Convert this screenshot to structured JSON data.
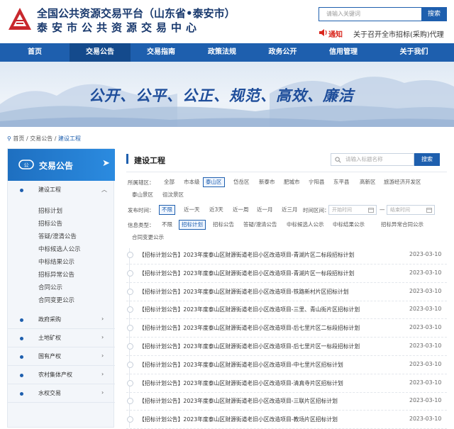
{
  "header": {
    "title_line1": "全国公共资源交易平台（山东省•泰安市）",
    "title_line2": "泰安市公共资源交易中心",
    "search_placeholder": "请输入关键词",
    "search_button": "搜索",
    "notice_label": "通知",
    "notice_text": "关于召开全市招标(采购)代理"
  },
  "nav": {
    "items": [
      "首页",
      "交易公告",
      "交易指南",
      "政策法规",
      "政务公开",
      "信用管理",
      "关于我们"
    ],
    "active_index": 1
  },
  "banner": {
    "slogan": "公开、公平、公正、规范、高效、廉洁"
  },
  "breadcrumb": {
    "home": "首页",
    "sep1": "/",
    "level1": "交易公告",
    "sep2": "/",
    "current": "建设工程"
  },
  "sidebar": {
    "heading": "交易公告",
    "heading_arrow": "➤",
    "expanded_section": {
      "label": "建设工程",
      "items": [
        "招标计划",
        "招标公告",
        "答疑/澄清公告",
        "中标候选人公示",
        "中标结果公示",
        "招标异常公告",
        "合同公示",
        "合同变更公示"
      ]
    },
    "sections": [
      "政府采购",
      "土地矿权",
      "国有产权",
      "农村集体产权",
      "水权交易"
    ]
  },
  "main": {
    "title": "建设工程",
    "search_placeholder": "请输入标题名称",
    "search_button": "搜索",
    "filters": {
      "region": {
        "label": "所属辖区：",
        "options": [
          "全部",
          "市本级",
          "泰山区",
          "岱岳区",
          "新泰市",
          "肥城市",
          "宁阳县",
          "东平县",
          "高新区",
          "旅游经济开发区",
          "泰山景区",
          "徂汶景区"
        ],
        "active_index": 2
      },
      "time": {
        "label": "发布时间：",
        "options": [
          "不限",
          "近一天",
          "近3天",
          "近一周",
          "近一月",
          "近三月"
        ],
        "active_index": 0,
        "range_label": "时间区间：",
        "start_placeholder": "开始时间",
        "end_placeholder": "结束时间",
        "range_sep": "—"
      },
      "info_type": {
        "label": "信息类型：",
        "options": [
          "不限",
          "招标计划",
          "招标公告",
          "答疑/澄清公告",
          "中标候选人公示",
          "中标结果公示",
          "招标异常",
          "合同公示",
          "合同变更公示"
        ],
        "active_index": 1
      }
    },
    "rows": [
      {
        "title": "【招标计划公告】2023年度泰山区财源街道老旧小区改造项目-青湖片区二标段招标计划",
        "date": "2023-03-10"
      },
      {
        "title": "【招标计划公告】2023年度泰山区财源街道老旧小区改造项目-青湖片区一标段招标计划",
        "date": "2023-03-10"
      },
      {
        "title": "【招标计划公告】2023年度泰山区财源街道老旧小区改造项目-铁路新村片区招标计划",
        "date": "2023-03-10"
      },
      {
        "title": "【招标计划公告】2023年度泰山区财源街道老旧小区改造项目-三里、青山街片区招标计划",
        "date": "2023-03-10"
      },
      {
        "title": "【招标计划公告】2023年度泰山区财源街道老旧小区改造项目-后七里片区二标段招标计划",
        "date": "2023-03-10"
      },
      {
        "title": "【招标计划公告】2023年度泰山区财源街道老旧小区改造项目-后七里片区一标段招标计划",
        "date": "2023-03-10"
      },
      {
        "title": "【招标计划公告】2023年度泰山区财源街道老旧小区改造项目-中七里片区招标计划",
        "date": "2023-03-10"
      },
      {
        "title": "【招标计划公告】2023年度泰山区财源街道老旧小区改造项目-清真寺片区招标计划",
        "date": "2023-03-10"
      },
      {
        "title": "【招标计划公告】2023年度泰山区财源街道老旧小区改造项目-三联片区招标计划",
        "date": "2023-03-10"
      },
      {
        "title": "【招标计划公告】2023年度泰山区财源街道老旧小区改造项目-教场片区招标计划",
        "date": "2023-03-10"
      }
    ]
  },
  "colors": {
    "brand_blue": "#1e5fae",
    "nav_active": "#144a8c",
    "notice_red": "#d9261c",
    "logo_red": "#c8282e"
  }
}
